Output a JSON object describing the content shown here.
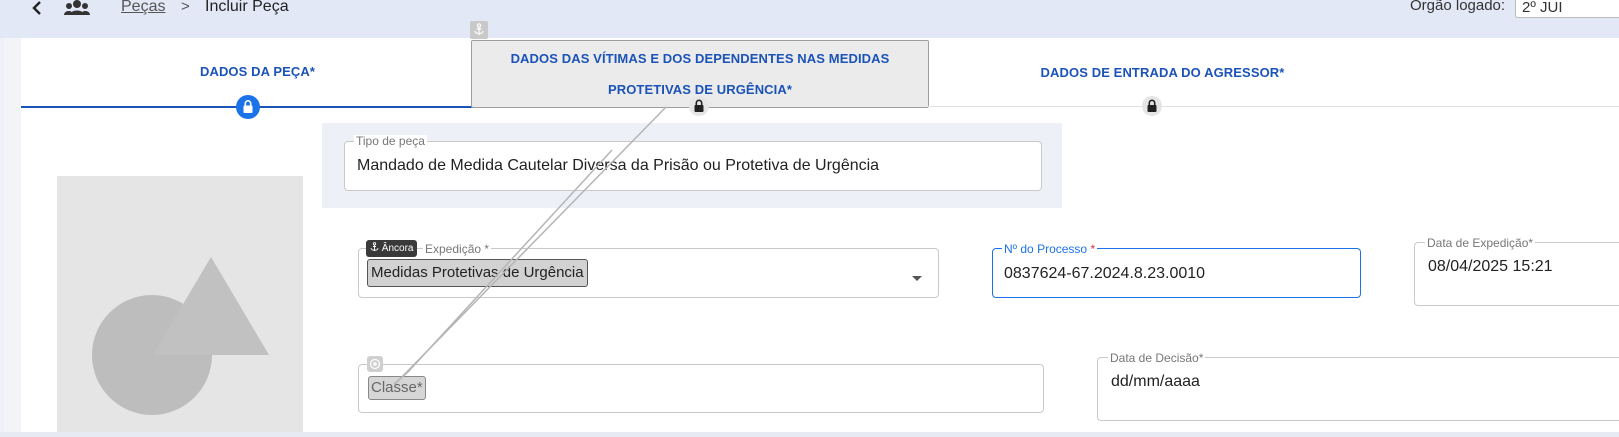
{
  "breadcrumb": {
    "back_icon": "chevron-left-icon",
    "users_icon": "users-icon",
    "parent_link": "Peças",
    "separator": ">",
    "current": "Incluir Peça"
  },
  "header": {
    "orgao_label": "Órgão logado:",
    "orgao_value": "2º JUI"
  },
  "tabs": [
    {
      "label": "DADOS DA PEÇA*",
      "active": true
    },
    {
      "label_line1": "DADOS DAS VÍTIMAS E DOS DEPENDENTES NAS MEDIDAS",
      "label_line2": "PROTETIVAS DE URGÊNCIA*",
      "active": false
    },
    {
      "label": "DADOS DE ENTRADA DO AGRESSOR*",
      "active": false
    }
  ],
  "form": {
    "tipo_peca": {
      "label": "Tipo de peça",
      "value": "Mandado de Medida Cautelar Diversa da Prisão ou Protetiva de Urgência"
    },
    "expedicao": {
      "label": "Expedição *",
      "value": "Medidas Protetivas de Urgência"
    },
    "processo": {
      "label": "Nº do Processo",
      "required_mark": "*",
      "value": "0837624-67.2024.8.23.0010"
    },
    "data_expedicao": {
      "label": "Data de Expedição*",
      "value": "08/04/2025 15:21"
    },
    "classe": {
      "placeholder": "Classe*"
    },
    "data_decisao": {
      "label": "Data de Decisão*",
      "value": "dd/mm/aaaa"
    }
  },
  "anchor_badge": {
    "icon": "anchor-icon",
    "label": "Âncora"
  },
  "colors": {
    "accent": "#1b53b8",
    "topbar": "#e3e8f6",
    "required": "#d32f2f"
  }
}
